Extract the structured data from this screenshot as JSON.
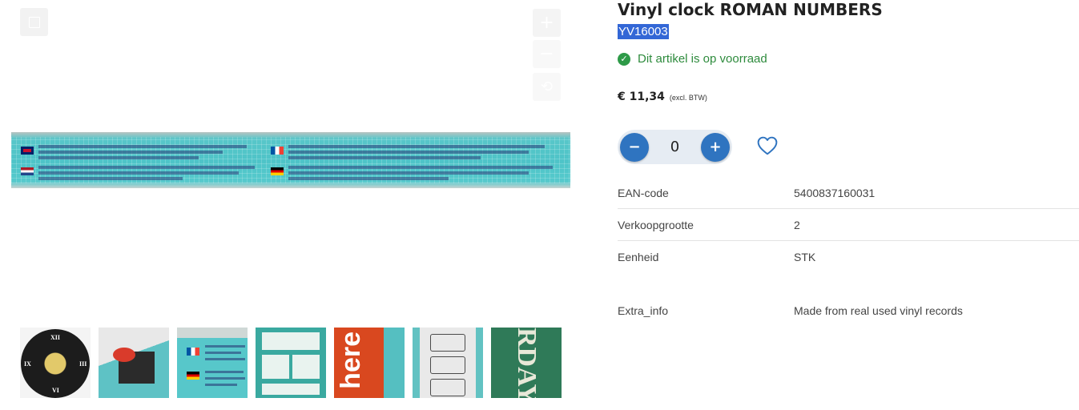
{
  "gallery": {
    "controls": {
      "fullscreen_icon": "fullscreen-icon",
      "zoom_in": "+",
      "zoom_out": "−",
      "reset": "⟲"
    },
    "thumbnails": [
      {
        "name": "thumbnail-1"
      },
      {
        "name": "thumbnail-2"
      },
      {
        "name": "thumbnail-3"
      },
      {
        "name": "thumbnail-4"
      },
      {
        "name": "thumbnail-5",
        "text": "here"
      },
      {
        "name": "thumbnail-6"
      },
      {
        "name": "thumbnail-7",
        "text": "RDAY'"
      }
    ],
    "roman_numerals": [
      "XII",
      "III",
      "VI",
      "IX"
    ]
  },
  "product": {
    "title": "Vinyl clock ROMAN NUMBERS",
    "sku": "YV16003",
    "stock_text": "Dit artikel is op voorraad",
    "price": "€ 11,34",
    "price_note": "(excl. BTW)",
    "quantity": "0",
    "minus": "−",
    "plus": "+",
    "check": "✓"
  },
  "specs": [
    {
      "key": "EAN-code",
      "value": "5400837160031"
    },
    {
      "key": "Verkoopgrootte",
      "value": "2"
    },
    {
      "key": "Eenheid",
      "value": "STK"
    },
    {
      "key": "Extra_info",
      "value": "Made from real used vinyl records"
    }
  ],
  "colors": {
    "accent": "#2f74c0",
    "stock_green": "#2e8b3d",
    "sku_highlight": "#3367d6"
  }
}
